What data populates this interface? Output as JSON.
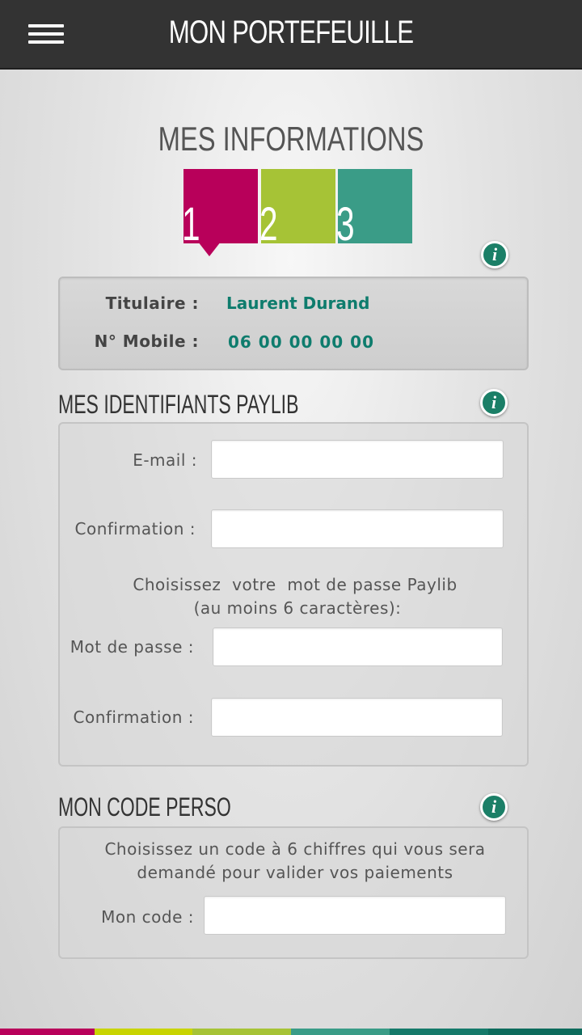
{
  "header": {
    "title": "MON PORTEFEUILLE",
    "menu_icon": "hamburger-menu-icon"
  },
  "page": {
    "title": "MES INFORMATIONS"
  },
  "steps": [
    {
      "label": "1",
      "color": "#b8005a",
      "active": true
    },
    {
      "label": "2",
      "color": "#a6c336",
      "active": false
    },
    {
      "label": "3",
      "color": "#3a9c87",
      "active": false
    }
  ],
  "holder": {
    "titulaire_label": "Titulaire :",
    "titulaire_value": "Laurent Durand",
    "mobile_label": "N° Mobile :",
    "mobile_value": "06 00 00 00 00"
  },
  "identifiants": {
    "title": "MES IDENTIFIANTS PAYLIB",
    "email_label": "E-mail :",
    "email_value": "",
    "email_confirm_label": "Confirmation :",
    "email_confirm_value": "",
    "password_hint_line1": "Choisissez  votre  mot de passe Paylib",
    "password_hint_line2": "(au moins 6 caractères):",
    "password_label": "Mot de passe :",
    "password_value": "",
    "password_confirm_label": "Confirmation :",
    "password_confirm_value": ""
  },
  "code_perso": {
    "title": "MON CODE PERSO",
    "hint_line1": "Choisissez un code à 6 chiffres qui vous sera",
    "hint_line2": "demandé pour valider vos paiements",
    "code_label": "Mon code :",
    "code_value": ""
  },
  "info_icon": "info-icon",
  "accent_colors": {
    "header_bg": "#333333",
    "value_text": "#0e7c6d",
    "info_icon": "#1b7f67"
  },
  "bottom_bar_colors": [
    "#b8005a",
    "#c8d400",
    "#a6c336",
    "#3a9c87",
    "#157a6a",
    "#0d6b5c"
  ]
}
